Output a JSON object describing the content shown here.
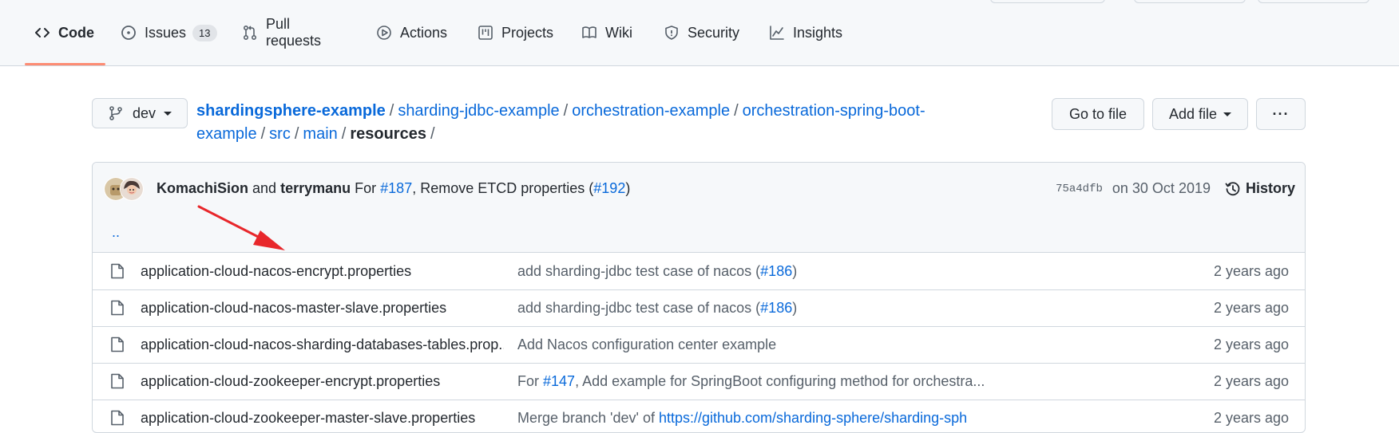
{
  "tabs": [
    {
      "label": "Code",
      "icon": "code-icon"
    },
    {
      "label": "Issues",
      "icon": "issue-icon",
      "count": "13"
    },
    {
      "label": "Pull requests",
      "icon": "pull-request-icon"
    },
    {
      "label": "Actions",
      "icon": "play-icon"
    },
    {
      "label": "Projects",
      "icon": "project-icon"
    },
    {
      "label": "Wiki",
      "icon": "book-icon"
    },
    {
      "label": "Security",
      "icon": "shield-icon"
    },
    {
      "label": "Insights",
      "icon": "graph-icon"
    }
  ],
  "selected_tab": "Code",
  "branch": {
    "name": "dev"
  },
  "breadcrumb": {
    "root": "shardingsphere-example",
    "parts": [
      "sharding-jdbc-example",
      "orchestration-example",
      "orchestration-spring-boot-example",
      "src",
      "main"
    ],
    "current": "resources",
    "separator": "/"
  },
  "actions": {
    "go_to_file": "Go to file",
    "add_file": "Add file",
    "more": "···"
  },
  "commit": {
    "author1": "KomachiSion",
    "and": "and",
    "author2": "terrymanu",
    "message_prefix": "For",
    "issue_ref": "#187",
    "message_mid": ", Remove ETCD properties (",
    "pr_ref": "#192",
    "message_suffix": ")",
    "sha": "75a4dfb",
    "date": "on 30 Oct 2019",
    "history_label": "History"
  },
  "parent_dir": "..",
  "files": [
    {
      "name": "application-cloud-nacos-encrypt.properties",
      "msg_prefix": "add sharding-jdbc test case of nacos (",
      "msg_link": "#186",
      "msg_suffix": ")",
      "age": "2 years ago"
    },
    {
      "name": "application-cloud-nacos-master-slave.properties",
      "msg_prefix": "add sharding-jdbc test case of nacos (",
      "msg_link": "#186",
      "msg_suffix": ")",
      "age": "2 years ago"
    },
    {
      "name": "application-cloud-nacos-sharding-databases-tables.prop...",
      "msg_prefix": "Add Nacos configuration center example",
      "msg_link": "",
      "msg_suffix": "",
      "age": "2 years ago"
    },
    {
      "name": "application-cloud-zookeeper-encrypt.properties",
      "msg_prefix": "For ",
      "msg_link": "#147",
      "msg_suffix": ", Add example for SpringBoot configuring method for orchestra...",
      "age": "2 years ago"
    },
    {
      "name": "application-cloud-zookeeper-master-slave.properties",
      "msg_prefix": "Merge branch 'dev' of ",
      "msg_link": "https://github.com/sharding-sphere/sharding-sph",
      "msg_suffix": "",
      "age": "2 years ago"
    }
  ],
  "colors": {
    "accent_underline": "#fd8c73",
    "link": "#0969da",
    "annotation_arrow": "#e8272b"
  }
}
